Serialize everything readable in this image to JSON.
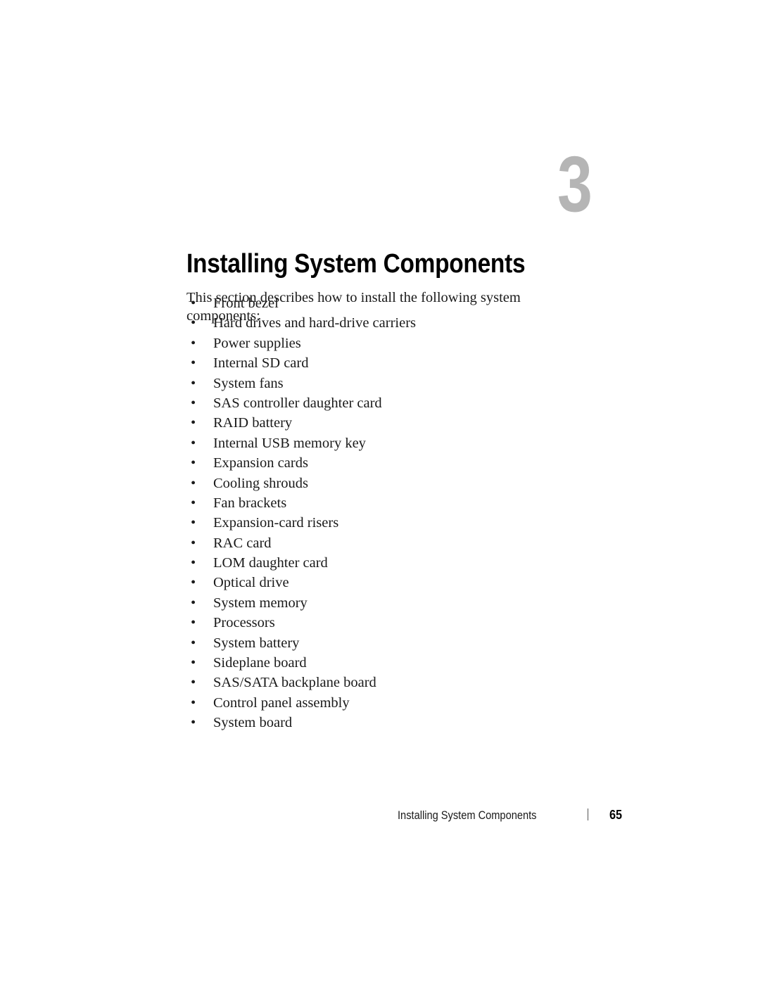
{
  "document": {
    "chapter_number": "3",
    "chapter_title": "Installing System Components",
    "intro_paragraph": "This section describes how to install the following system components:",
    "bullet_glyph": "•",
    "components": [
      {
        "label": "Front bezel"
      },
      {
        "label": "Hard drives and hard-drive carriers"
      },
      {
        "label": "Power supplies"
      },
      {
        "label": "Internal SD card"
      },
      {
        "label": "System fans"
      },
      {
        "label": "SAS controller daughter card"
      },
      {
        "label": "RAID battery"
      },
      {
        "label": "Internal USB memory key"
      },
      {
        "label": "Expansion cards"
      },
      {
        "label": "Cooling shrouds"
      },
      {
        "label": "Fan brackets"
      },
      {
        "label": "Expansion-card risers"
      },
      {
        "label": "RAC card"
      },
      {
        "label": "LOM daughter card"
      },
      {
        "label": "Optical drive"
      },
      {
        "label": "System memory"
      },
      {
        "label": "Processors"
      },
      {
        "label": "System battery"
      },
      {
        "label": "Sideplane board"
      },
      {
        "label": "SAS/SATA backplane board"
      },
      {
        "label": "Control panel assembly"
      },
      {
        "label": "System board"
      }
    ]
  },
  "footer": {
    "running_title": "Installing System Components",
    "separator": "|",
    "page_number": "65"
  },
  "colors": {
    "page_background": "#ffffff",
    "body_text": "#1a1a1a",
    "heading_text": "#000000",
    "chapter_number": "#b5b5b5",
    "footer_rule": "#555555"
  }
}
